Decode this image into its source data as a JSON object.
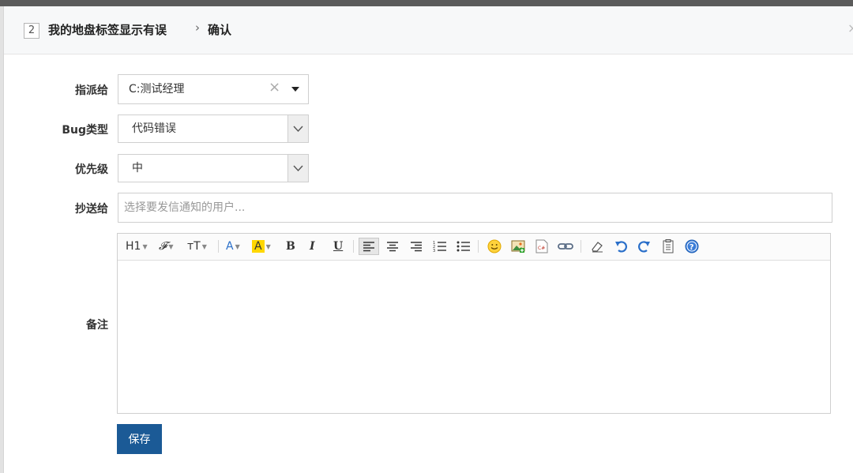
{
  "header": {
    "bug_id": "2",
    "title": "我的地盘标签显示有误",
    "separator": "›",
    "action": "确认"
  },
  "form": {
    "assign_label": "指派给",
    "assign_value": "C:测试经理",
    "bug_type_label": "Bug类型",
    "bug_type_value": "代码错误",
    "priority_label": "优先级",
    "priority_value": "中",
    "cc_label": "抄送给",
    "cc_placeholder": "选择要发信通知的用户...",
    "comment_label": "备注"
  },
  "toolbar": {
    "heading": "H1",
    "font_family": "𝓕",
    "font_size": "тT",
    "font_color": "A",
    "bg_color": "A",
    "bold": "B",
    "italic": "I",
    "underline": "U"
  },
  "icons": [
    "heading-icon",
    "font-family-icon",
    "font-size-icon",
    "font-color-icon",
    "highlight-icon",
    "bold-icon",
    "italic-icon",
    "underline-icon",
    "align-left-icon",
    "align-center-icon",
    "align-right-icon",
    "ordered-list-icon",
    "unordered-list-icon",
    "emoticon-icon",
    "image-icon",
    "code-icon",
    "link-icon",
    "eraser-icon",
    "undo-icon",
    "redo-icon",
    "paste-word-icon",
    "help-icon"
  ],
  "colors": {
    "accent": "#1b5a96",
    "highlight": "#ffd700",
    "font_color": "#2a6fc9"
  },
  "actions": {
    "save_label": "保存"
  }
}
